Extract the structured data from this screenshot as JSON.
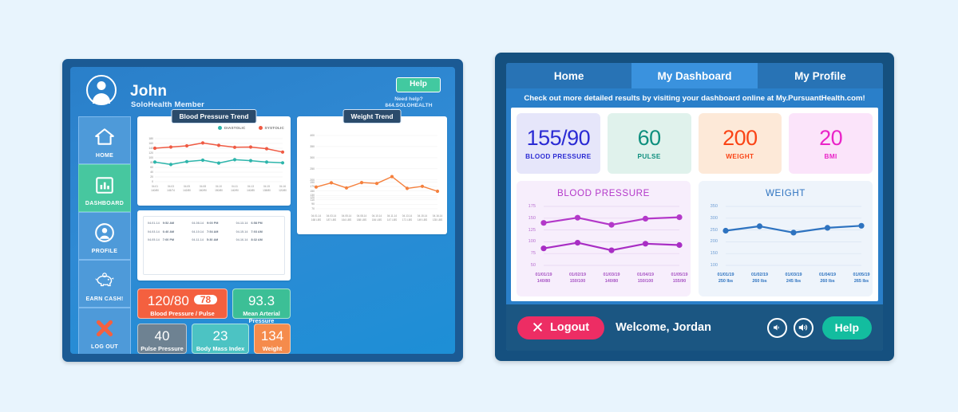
{
  "colors": {
    "page_bg": "#e8f4fd",
    "legacy_frame": "#1b5a94",
    "legacy_bg": "#2f8ad4",
    "accent_green": "#42c9a0",
    "systolic": "#ef5a43",
    "diastolic": "#2db5ab",
    "weight_line": "#f5813e",
    "modern_bp": "#b338c9",
    "modern_weight": "#2e73c0",
    "logout_pink": "#ed2d64",
    "help_teal": "#13bd9f"
  },
  "legacy_kiosk": {
    "user_name": "John",
    "user_role": "SoloHealth Member",
    "help_button": "Help",
    "help_note_line1": "Need help?",
    "help_note_line2": "844.SOLOHEALTH",
    "nav": [
      {
        "label": "HOME",
        "icon": "home-icon",
        "active": false
      },
      {
        "label": "DASHBOARD",
        "icon": "bar-chart-icon",
        "active": true
      },
      {
        "label": "PROFILE",
        "icon": "person-icon",
        "active": false
      },
      {
        "label": "EARN CASH!",
        "icon": "piggy-bank-icon",
        "active": false
      },
      {
        "label": "LOG OUT",
        "icon": "x-cross-icon",
        "active": false
      }
    ],
    "bp_chart_title": "Blood Pressure Trend",
    "weight_chart_title": "Weight Trend",
    "legend": [
      {
        "label": "DIASTOLIC",
        "color": "#2db5ab"
      },
      {
        "label": "SYSTOLIC",
        "color": "#ef5a43"
      }
    ],
    "readings_table": [
      [
        {
          "date": "04.01.14",
          "time": "9:52 AM"
        },
        {
          "date": "04.08.14",
          "time": "9:00 PM"
        },
        {
          "date": "04.13.14",
          "time": "6:58 PM"
        }
      ],
      [
        {
          "date": "04.03.14",
          "time": "6:40 AM"
        },
        {
          "date": "04.10.14",
          "time": "7:54 AM"
        },
        {
          "date": "04.15.14",
          "time": "7:03 AM"
        }
      ],
      [
        {
          "date": "04.05.14",
          "time": "7:00 PM"
        },
        {
          "date": "04.11.14",
          "time": "5:30 AM"
        },
        {
          "date": "04.16.14",
          "time": "8:32 AM"
        }
      ]
    ],
    "stats": [
      {
        "name": "blood-pressure-pulse",
        "value": "120/80",
        "pill": "78",
        "label": "Blood Pressure / Pulse",
        "color": "#f4603f"
      },
      {
        "name": "mean-arterial-pressure",
        "value": "93.3",
        "label": "Mean Arterial Pressure",
        "color": "#3cbf96"
      },
      {
        "name": "pulse-pressure",
        "value": "40",
        "label": "Pulse Pressure",
        "color": "#6e8292"
      },
      {
        "name": "body-mass-index",
        "value": "23",
        "label": "Body Mass Index",
        "color": "#4cc3c3"
      },
      {
        "name": "weight",
        "value": "134",
        "label": "Weight",
        "color": "#f58b4c"
      }
    ]
  },
  "modern_kiosk": {
    "tabs": [
      {
        "label": "Home",
        "active": false
      },
      {
        "label": "My Dashboard",
        "active": true
      },
      {
        "label": "My Profile",
        "active": false
      }
    ],
    "banner": "Check out more detailed results by visiting your dashboard online at My.PursuantHealth.com!",
    "metrics": [
      {
        "value": "155/90",
        "label": "BLOOD PRESSURE",
        "value_color": "#2b2bd4",
        "bg": "#e6e6fa"
      },
      {
        "value": "60",
        "label": "PULSE",
        "value_color": "#0e8f7e",
        "bg": "#e0f2ec"
      },
      {
        "value": "200",
        "label": "WEIGHT",
        "value_color": "#fa4416",
        "bg": "#fde9d8"
      },
      {
        "value": "20",
        "label": "BMI",
        "value_color": "#ea23c8",
        "bg": "#fbe4fa"
      }
    ],
    "footer": {
      "logout_label": "Logout",
      "logout_icon": "x-cross-icon",
      "welcome": "Welcome, Jordan",
      "volume_down_icon": "volume-low-icon",
      "volume_up_icon": "volume-high-icon",
      "help_label": "Help"
    }
  },
  "chart_data": [
    {
      "id": "legacy-blood-pressure-trend",
      "type": "line",
      "title": "Blood Pressure Trend",
      "xlabel": "",
      "ylabel": "",
      "ylim": [
        0,
        180
      ],
      "yticks": [
        0,
        20,
        40,
        60,
        80,
        100,
        120,
        140,
        160,
        180
      ],
      "grid": true,
      "legend_position": "top-right",
      "categories": [
        "04.01",
        "04.03",
        "04.05",
        "04.08",
        "04.10",
        "04.11",
        "04.13",
        "04.15",
        "04.16"
      ],
      "tick_sublabels": [
        "140/80",
        "145/74",
        "142/80",
        "160/90",
        "150/80",
        "140/90",
        "140/85",
        "138/80",
        "120/80"
      ],
      "series": [
        {
          "name": "SYSTOLIC",
          "color": "#ef5a43",
          "values": [
            140,
            145,
            150,
            162,
            152,
            144,
            145,
            138,
            124
          ]
        },
        {
          "name": "DIASTOLIC",
          "color": "#2db5ab",
          "values": [
            82,
            72,
            84,
            90,
            78,
            92,
            88,
            82,
            79
          ]
        }
      ]
    },
    {
      "id": "legacy-weight-trend",
      "type": "line",
      "title": "Weight Trend",
      "xlabel": "",
      "ylabel": "",
      "ylim": [
        70,
        400
      ],
      "yticks": [
        70,
        90,
        110,
        120,
        130,
        150,
        170,
        190,
        200,
        250,
        300,
        350,
        400
      ],
      "grid": true,
      "categories": [
        "04.01.14",
        "04.03.14",
        "04.05.14",
        "04.08.14",
        "04.10.14",
        "04.11.14",
        "04.13.14",
        "04.15.14",
        "04.16.14"
      ],
      "tick_sublabels": [
        "168 LBS",
        "187 LBS",
        "164 LBS",
        "188 LBS",
        "184 LBS",
        "147 LBS",
        "171 LBS",
        "149 LBS",
        "135 LBS"
      ],
      "series": [
        {
          "name": "WEIGHT",
          "color": "#f5813e",
          "values": [
            168,
            187,
            164,
            188,
            184,
            215,
            162,
            171,
            149,
            135
          ]
        }
      ]
    },
    {
      "id": "modern-blood-pressure",
      "type": "line",
      "title": "BLOOD PRESSURE",
      "xlabel": "",
      "ylabel": "",
      "ylim": [
        50,
        175
      ],
      "yticks": [
        50,
        75,
        100,
        125,
        150,
        175
      ],
      "grid": true,
      "categories": [
        "01/01/19",
        "01/02/19",
        "01/03/19",
        "01/04/19",
        "01/05/19"
      ],
      "tick_sublabels": [
        "140/80",
        "150/100",
        "140/80",
        "150/100",
        "155/90"
      ],
      "series": [
        {
          "name": "Systolic",
          "color": "#b338c9",
          "values": [
            140,
            151,
            136,
            149,
            152
          ]
        },
        {
          "name": "Diastolic",
          "color": "#a82dc4",
          "values": [
            86,
            98,
            82,
            96,
            93
          ]
        }
      ]
    },
    {
      "id": "modern-weight",
      "type": "line",
      "title": "WEIGHT",
      "xlabel": "",
      "ylabel": "",
      "ylim": [
        100,
        350
      ],
      "yticks": [
        100,
        150,
        200,
        250,
        300,
        350
      ],
      "grid": true,
      "categories": [
        "01/01/19",
        "01/02/19",
        "01/03/19",
        "01/04/19",
        "01/05/19"
      ],
      "tick_sublabels": [
        "250 lbs",
        "260 lbs",
        "245 lbs",
        "260 lbs",
        "265 lbs"
      ],
      "series": [
        {
          "name": "Weight",
          "color": "#2e73c0",
          "values": [
            247,
            266,
            239,
            259,
            268
          ]
        }
      ]
    }
  ]
}
